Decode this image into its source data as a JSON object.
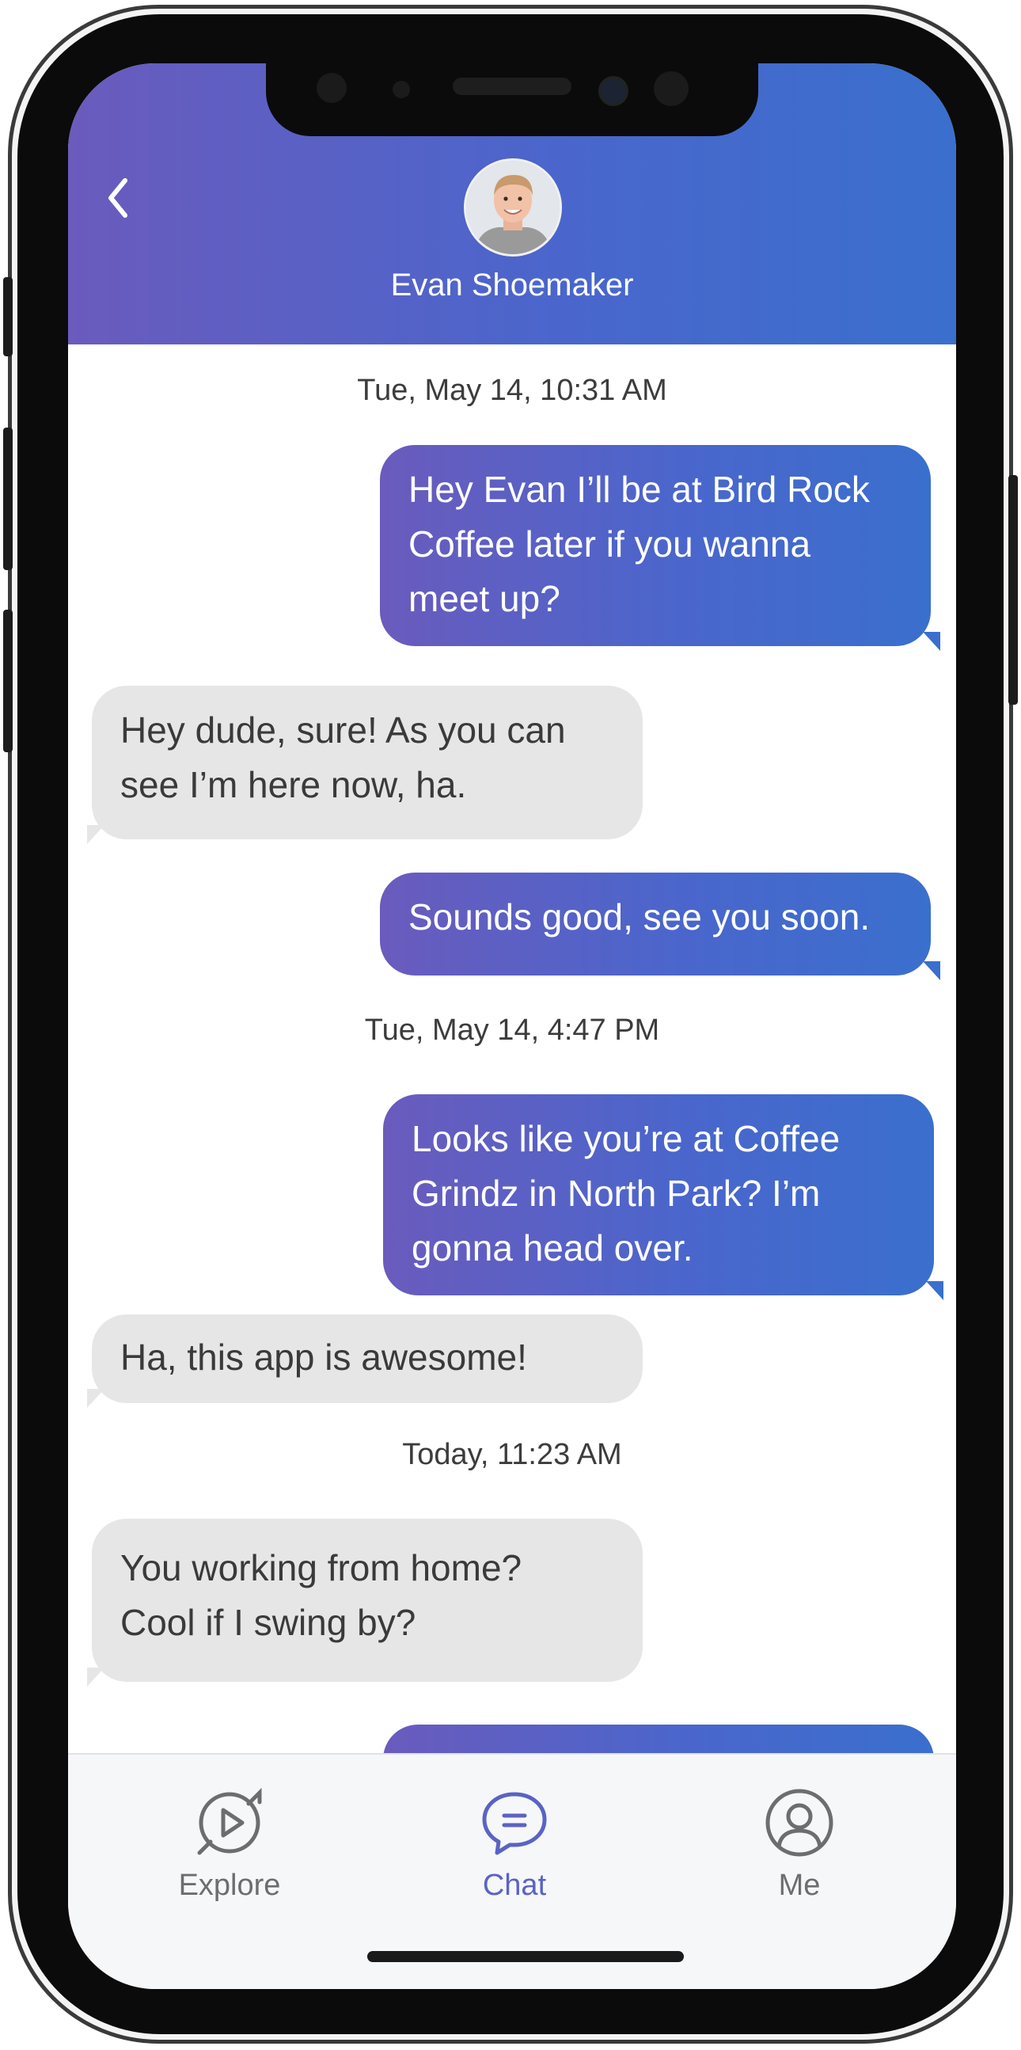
{
  "header": {
    "contact_name": "Evan Shoemaker",
    "back_icon": "chevron-left-icon",
    "avatar": "profile-photo"
  },
  "messages": [
    {
      "type": "timestamp",
      "text": "Tue, May 14, 10:31 AM"
    },
    {
      "type": "outgoing",
      "lines": [
        "Hey Evan I’ll be at Bird Rock",
        "Coffee later if you wanna",
        "meet up?"
      ]
    },
    {
      "type": "incoming",
      "lines": [
        "Hey dude, sure! As you can",
        "see I’m here now, ha."
      ]
    },
    {
      "type": "outgoing",
      "lines": [
        "Sounds good, see you soon."
      ]
    },
    {
      "type": "timestamp",
      "text": "Tue, May 14, 4:47 PM"
    },
    {
      "type": "outgoing",
      "lines": [
        "Looks like you’re at Coffee",
        "Grindz in North Park? I’m",
        "gonna head over."
      ]
    },
    {
      "type": "incoming",
      "lines": [
        "Ha, this app is awesome!"
      ]
    },
    {
      "type": "timestamp",
      "text": "Today, 11:23 AM"
    },
    {
      "type": "incoming",
      "lines": [
        "You working from home?",
        "Cool if I swing by?"
      ]
    }
  ],
  "tabbar": {
    "tabs": [
      {
        "label": "Explore",
        "icon": "explore-icon",
        "active": false
      },
      {
        "label": "Chat",
        "icon": "chat-icon",
        "active": true
      },
      {
        "label": "Me",
        "icon": "profile-icon",
        "active": false
      }
    ]
  },
  "colors": {
    "header_gradient_start": "#6a5bbd",
    "header_gradient_end": "#3a6fcd",
    "incoming_bubble": "#e6e6e6",
    "active_tab": "#5a63c4",
    "inactive_tab": "#6d6d6d"
  }
}
